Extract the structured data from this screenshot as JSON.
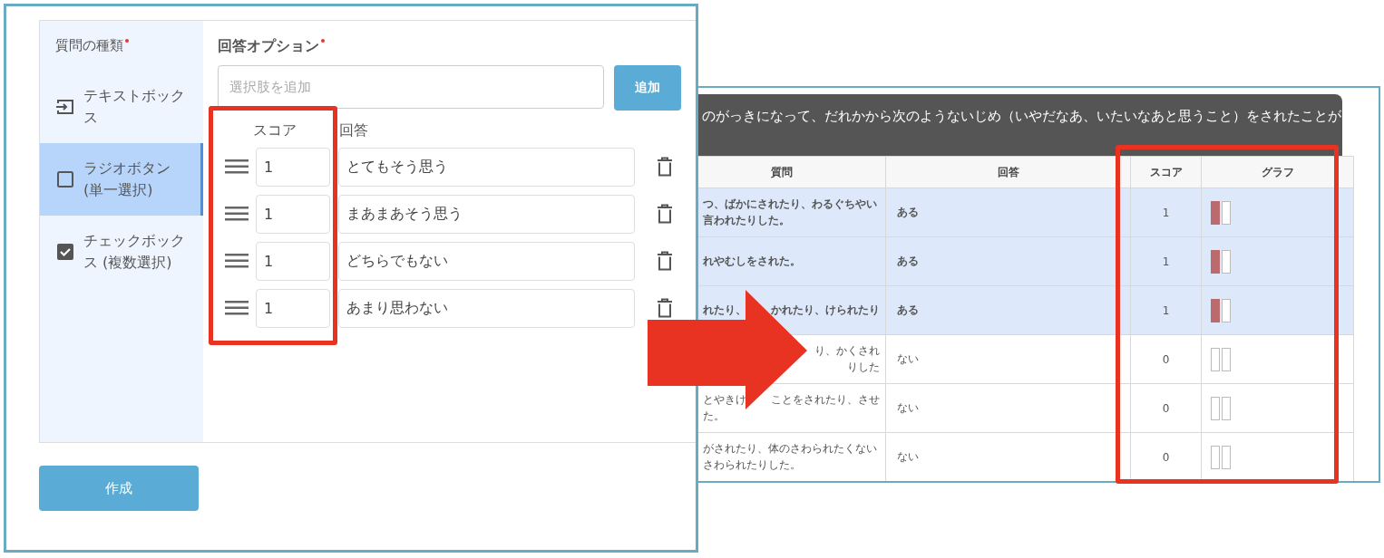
{
  "editor": {
    "sidebar": {
      "title": "質問の種類",
      "required": true,
      "items": [
        {
          "kind": "text",
          "label": "テキストボックス",
          "selected": false
        },
        {
          "kind": "radio",
          "label": "ラジオボタン(単一選択)",
          "selected": true
        },
        {
          "kind": "checkbox",
          "label": "チェックボックス (複数選択)",
          "selected": false
        }
      ]
    },
    "options": {
      "title": "回答オプション",
      "required": true,
      "add_field": {
        "placeholder": "選択肢を追加"
      },
      "add_button": "追加",
      "score_header": "スコア",
      "answer_header": "回答",
      "rows": [
        {
          "score": "1",
          "answer": "とてもそう思う"
        },
        {
          "score": "1",
          "answer": "まあまあそう思う"
        },
        {
          "score": "1",
          "answer": "どちらでもない"
        },
        {
          "score": "1",
          "answer": "あまり思わない"
        }
      ]
    },
    "create_button": "作成"
  },
  "results": {
    "question_text": "のがっきになって、だれかから次のようないじめ（いやだなあ、いたいなあと思うこと）をされたことが",
    "columns": [
      "質問",
      "回答",
      "スコア",
      "グラフ"
    ],
    "rows": [
      {
        "kind": "plain",
        "question": [
          [
            "つ、ばかにされたり、わるぐちやい"
          ],
          [
            "言われたりした。"
          ]
        ],
        "answer": "ある",
        "score": "1",
        "graph_filled": true,
        "highlighted": true
      },
      {
        "kind": "plain",
        "question": [
          [
            "れやむしをされた。"
          ]
        ],
        "answer": "ある",
        "score": "1",
        "graph_filled": true,
        "highlighted": true
      },
      {
        "kind": "plain",
        "question": [
          [
            "れたり、",
            "かれたり、けられたり"
          ]
        ],
        "answer": "ある",
        "score": "1",
        "graph_filled": true,
        "highlighted": true
      },
      {
        "kind": "covered",
        "question": [
          [
            "り、かくされ"
          ],
          [
            "りした"
          ]
        ],
        "answer": "ない",
        "score": "0",
        "graph_filled": false,
        "highlighted": false
      },
      {
        "kind": "plain",
        "question": [
          [
            "とやきけ",
            "ことをされたり、させ"
          ],
          [
            "た。"
          ]
        ],
        "answer": "ない",
        "score": "0",
        "graph_filled": false,
        "highlighted": false
      },
      {
        "kind": "plain",
        "question": [
          [
            "がされたり、体のさわられたくない"
          ],
          [
            "さわられたりした。"
          ]
        ],
        "answer": "ない",
        "score": "0",
        "graph_filled": false,
        "highlighted": false
      }
    ]
  }
}
